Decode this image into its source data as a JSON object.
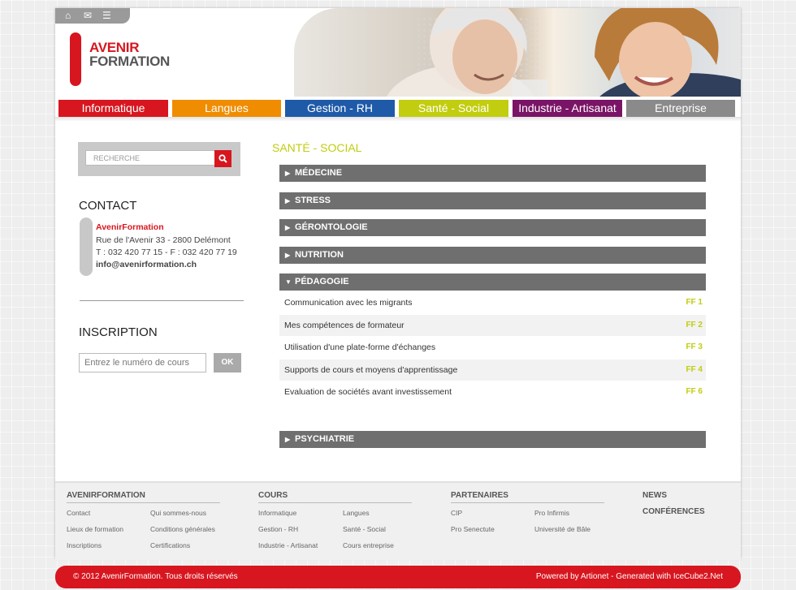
{
  "logo": {
    "line1": "AVENIR",
    "line2": "FORMATION"
  },
  "topicons": {
    "home": "home-icon",
    "mail": "mail-icon",
    "sitemap": "sitemap-icon"
  },
  "nav": [
    {
      "label": "Informatique",
      "color": "#d7161f"
    },
    {
      "label": "Langues",
      "color": "#f08c00"
    },
    {
      "label": "Gestion - RH",
      "color": "#1e5aa8"
    },
    {
      "label": "Santé - Social",
      "color": "#c2cd0f"
    },
    {
      "label": "Industrie - Artisanat",
      "color": "#7a1466"
    },
    {
      "label": "Entreprise",
      "color": "#8a8a8a"
    }
  ],
  "search": {
    "placeholder": "RECHERCHE",
    "icon": "search-icon"
  },
  "contact": {
    "title": "CONTACT",
    "name": "AvenirFormation",
    "address": "Rue de l'Avenir 33 - 2800 Delémont",
    "phone": "T : 032 420 77 15 - F : 032 420 77 19",
    "email": "info@avenirformation.ch"
  },
  "inscription": {
    "title": "INSCRIPTION",
    "placeholder": "Entrez le numéro de cours",
    "button": "OK"
  },
  "section": {
    "title": "SANTÉ - SOCIAL"
  },
  "categories": [
    {
      "label": "MÉDECINE",
      "arrow": "▶"
    },
    {
      "label": "STRESS",
      "arrow": "▶"
    },
    {
      "label": "GÉRONTOLOGIE",
      "arrow": "▶"
    },
    {
      "label": "NUTRITION",
      "arrow": "▶"
    },
    {
      "label": "PÉDAGOGIE",
      "arrow": "▼"
    },
    {
      "label": "PSYCHIATRIE",
      "arrow": "▶"
    }
  ],
  "courses": [
    {
      "title": "Communication avec les migrants",
      "code": "FF 1"
    },
    {
      "title": "Mes compétences de formateur",
      "code": "FF 2"
    },
    {
      "title": "Utilisation d'une plate-forme d'échanges",
      "code": "FF 3"
    },
    {
      "title": "Supports de cours et moyens d'apprentissage",
      "code": "FF 4"
    },
    {
      "title": "Evaluation de sociétés avant investissement",
      "code": "FF 6"
    }
  ],
  "footer": {
    "col1": {
      "title": "AVENIRFORMATION",
      "links": [
        "Contact",
        "Qui sommes-nous",
        "Lieux de formation",
        "Conditions générales",
        "Inscriptions",
        "Certifications"
      ]
    },
    "col2": {
      "title": "COURS",
      "links": [
        "Informatique",
        "Langues",
        "Gestion - RH",
        "Santé - Social",
        "Industrie - Artisanat",
        "Cours entreprise"
      ]
    },
    "col3": {
      "title": "PARTENAIRES",
      "links": [
        "CIP",
        "Pro Infirmis",
        "Pro Senectute",
        "Université de Bâle"
      ]
    },
    "col4": {
      "links": [
        "NEWS",
        "CONFÉRENCES"
      ]
    }
  },
  "bottom": {
    "copyright": "© 2012 AvenirFormation. Tous droits réservés",
    "powered": "Powered by Artionet - Generated with IceCube2.Net"
  }
}
